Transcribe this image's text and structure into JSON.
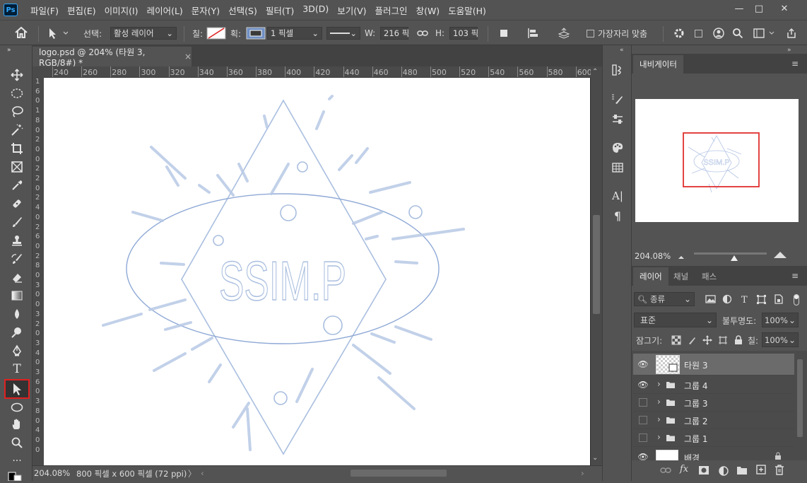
{
  "app": {
    "logo": "Ps"
  },
  "menu": [
    "파일(F)",
    "편집(E)",
    "이미지(I)",
    "레이어(L)",
    "문자(Y)",
    "선택(S)",
    "필터(T)",
    "3D(D)",
    "보기(V)",
    "플러그인",
    "창(W)",
    "도움말(H)"
  ],
  "window_controls": {
    "minimize": "—",
    "maximize": "□",
    "close": "✕"
  },
  "options": {
    "select_label": "선택:",
    "select_value": "활성 레이어",
    "fill_label": "칠:",
    "stroke_label": "획:",
    "stroke_width": "1 픽셀",
    "w_label": "W:",
    "w_value": "216 픽",
    "h_label": "H:",
    "h_value": "103 픽",
    "align_edges_label": "가장자리 맞춤"
  },
  "document": {
    "tab_title": "logo.psd @ 204% (타원 3, RGB/8#) *",
    "tab_close": "×",
    "ruler_top": [
      "240",
      "260",
      "280",
      "300",
      "320",
      "340",
      "360",
      "380",
      "400",
      "420",
      "440",
      "460",
      "480",
      "500",
      "520",
      "540",
      "560",
      "580",
      "600"
    ],
    "ruler_left": [
      "1",
      "6",
      "0",
      "1",
      "8",
      "0",
      "2",
      "0",
      "0",
      "2",
      "2",
      "0",
      "2",
      "4",
      "0",
      "2",
      "6",
      "0",
      "2",
      "8",
      "0",
      "3",
      "0",
      "0",
      "3",
      "2",
      "0",
      "3",
      "4",
      "0",
      "3",
      "6",
      "0",
      "3",
      "8",
      "0",
      "4",
      "0",
      "0"
    ],
    "logo_text": "SSIM.P",
    "logo_color": "#a9bedf"
  },
  "status": {
    "zoom": "204.08%",
    "doc_info": "800 픽셀 x 600 픽셀 (72 ppi)",
    "arrow": "〉"
  },
  "navigator": {
    "tab": "내비게이터",
    "zoom": "204.08%",
    "view_rect_color": "#e03030"
  },
  "layers_panel": {
    "tabs": [
      "레이어",
      "채널",
      "패스"
    ],
    "filter_kind": "종류",
    "blend_mode": "표준",
    "opacity_label": "불투명도:",
    "opacity_value": "100%",
    "lock_label": "잠그기:",
    "fill_label": "칠:",
    "fill_value": "100%",
    "layers": [
      {
        "name": "타원 3",
        "visible": true,
        "type": "shape",
        "selected": true
      },
      {
        "name": "그룹 4",
        "visible": true,
        "type": "group"
      },
      {
        "name": "그룹 3",
        "visible": false,
        "type": "group"
      },
      {
        "name": "그룹 2",
        "visible": false,
        "type": "group"
      },
      {
        "name": "그룹 1",
        "visible": false,
        "type": "group"
      },
      {
        "name": "배경",
        "visible": true,
        "type": "background"
      }
    ],
    "bottom_icons": [
      "link-icon",
      "fx-icon",
      "mask-icon",
      "adjustment-icon",
      "new-group-icon",
      "new-layer-icon",
      "delete-icon"
    ],
    "fx_label": "fx"
  },
  "toolbar_tools": [
    "move-tool",
    "marquee-tool",
    "lasso-tool",
    "magic-wand-tool",
    "crop-tool",
    "frame-tool",
    "eyedropper-tool",
    "healing-tool",
    "brush-tool",
    "stamp-tool",
    "history-brush-tool",
    "eraser-tool",
    "gradient-tool",
    "blur-tool",
    "dodge-tool",
    "pen-tool",
    "type-tool",
    "path-selection-tool",
    "ellipse-tool",
    "hand-tool",
    "zoom-tool",
    "more-tools"
  ],
  "type_tool_glyph": "T",
  "char_panel_glyph": "A|",
  "para_panel_glyph": "¶",
  "colors": {
    "ui_bg": "#535353",
    "dark": "#424242",
    "accent_red": "#e02020"
  }
}
